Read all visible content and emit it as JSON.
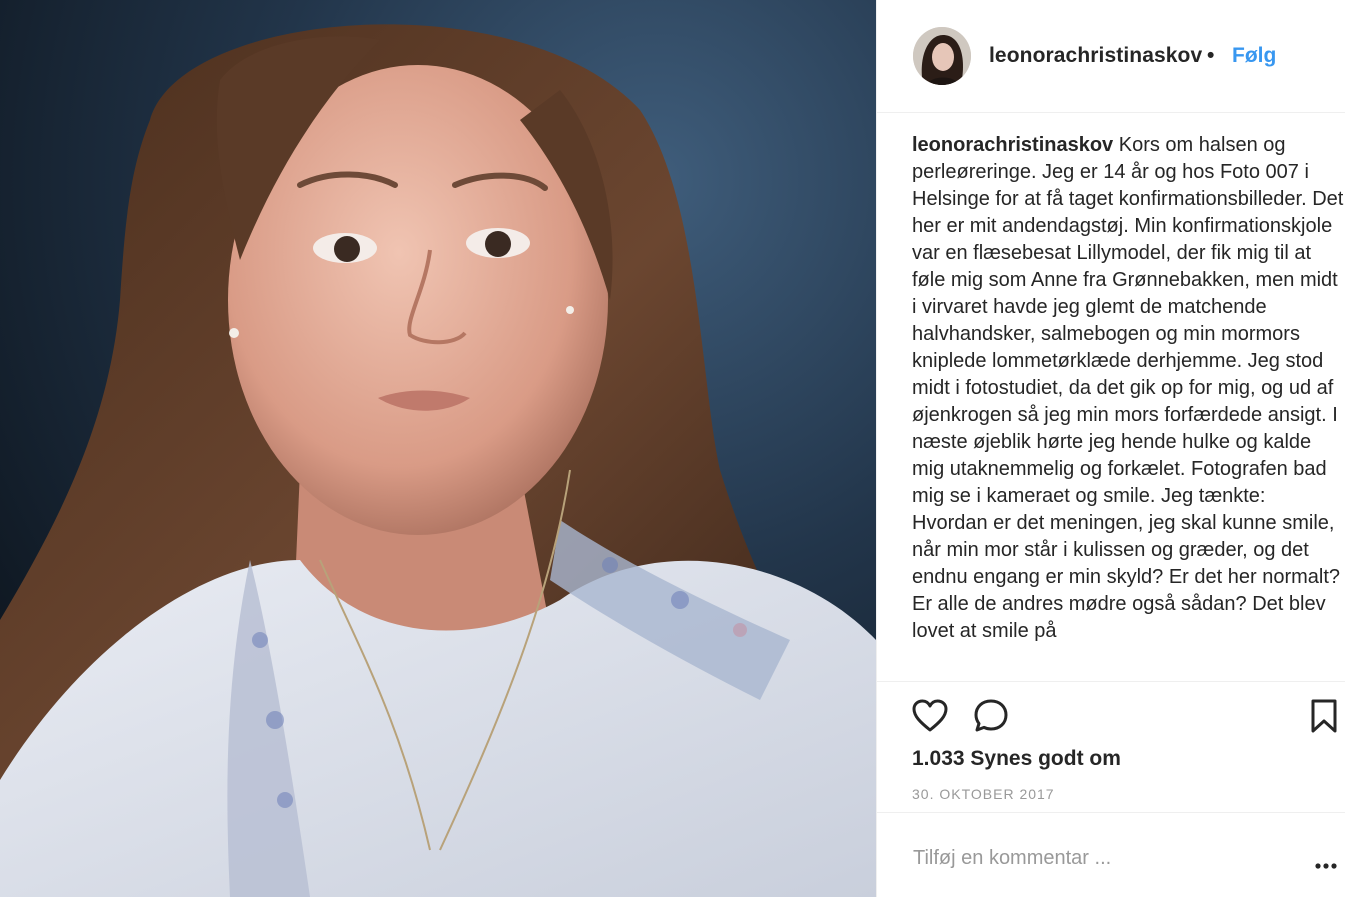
{
  "post": {
    "username": "leonorachristinaskov",
    "separator": "•",
    "follow_label": "Følg",
    "caption_username": "leonorachristinaskov",
    "caption_text": " Kors om halsen og perleøreringe. Jeg er 14 år og hos Foto 007 i Helsinge for at få taget konfirmationsbilleder. Det her er mit andendagstøj. Min konfirmationskjole var en flæsebesat Lillymodel, der fik mig til at føle mig som Anne fra Grønnebakken, men midt i virvaret havde jeg glemt de matchende halvhandsker, salmebogen og min mormors kniplede lommetørklæde derhjemme. Jeg stod midt i fotostudiet, da det gik op for mig, og ud af øjenkrogen så jeg min mors forfærdede ansigt. I næste øjeblik hørte jeg hende hulke og kalde mig utaknemmelig og forkælet. Fotografen bad mig se i kameraet og smile. Jeg tænkte: Hvordan er det meningen, jeg skal kunne smile, når min mor står i kulissen og græder, og det endnu engang er min skyld? Er det her normalt? Er alle de andres mødre også sådan? Det blev lovet at smile på",
    "likes": "1.033 Synes godt om",
    "date": "30. OKTOBER 2017",
    "comment_placeholder": "Tilføj en kommentar ..."
  },
  "icons": {
    "like": "heart-icon",
    "comment": "comment-bubble-icon",
    "save": "bookmark-icon",
    "more": "more-dots-icon"
  },
  "colors": {
    "link": "#3897f0",
    "text": "#262626",
    "muted": "#999999",
    "border": "#efefef"
  }
}
